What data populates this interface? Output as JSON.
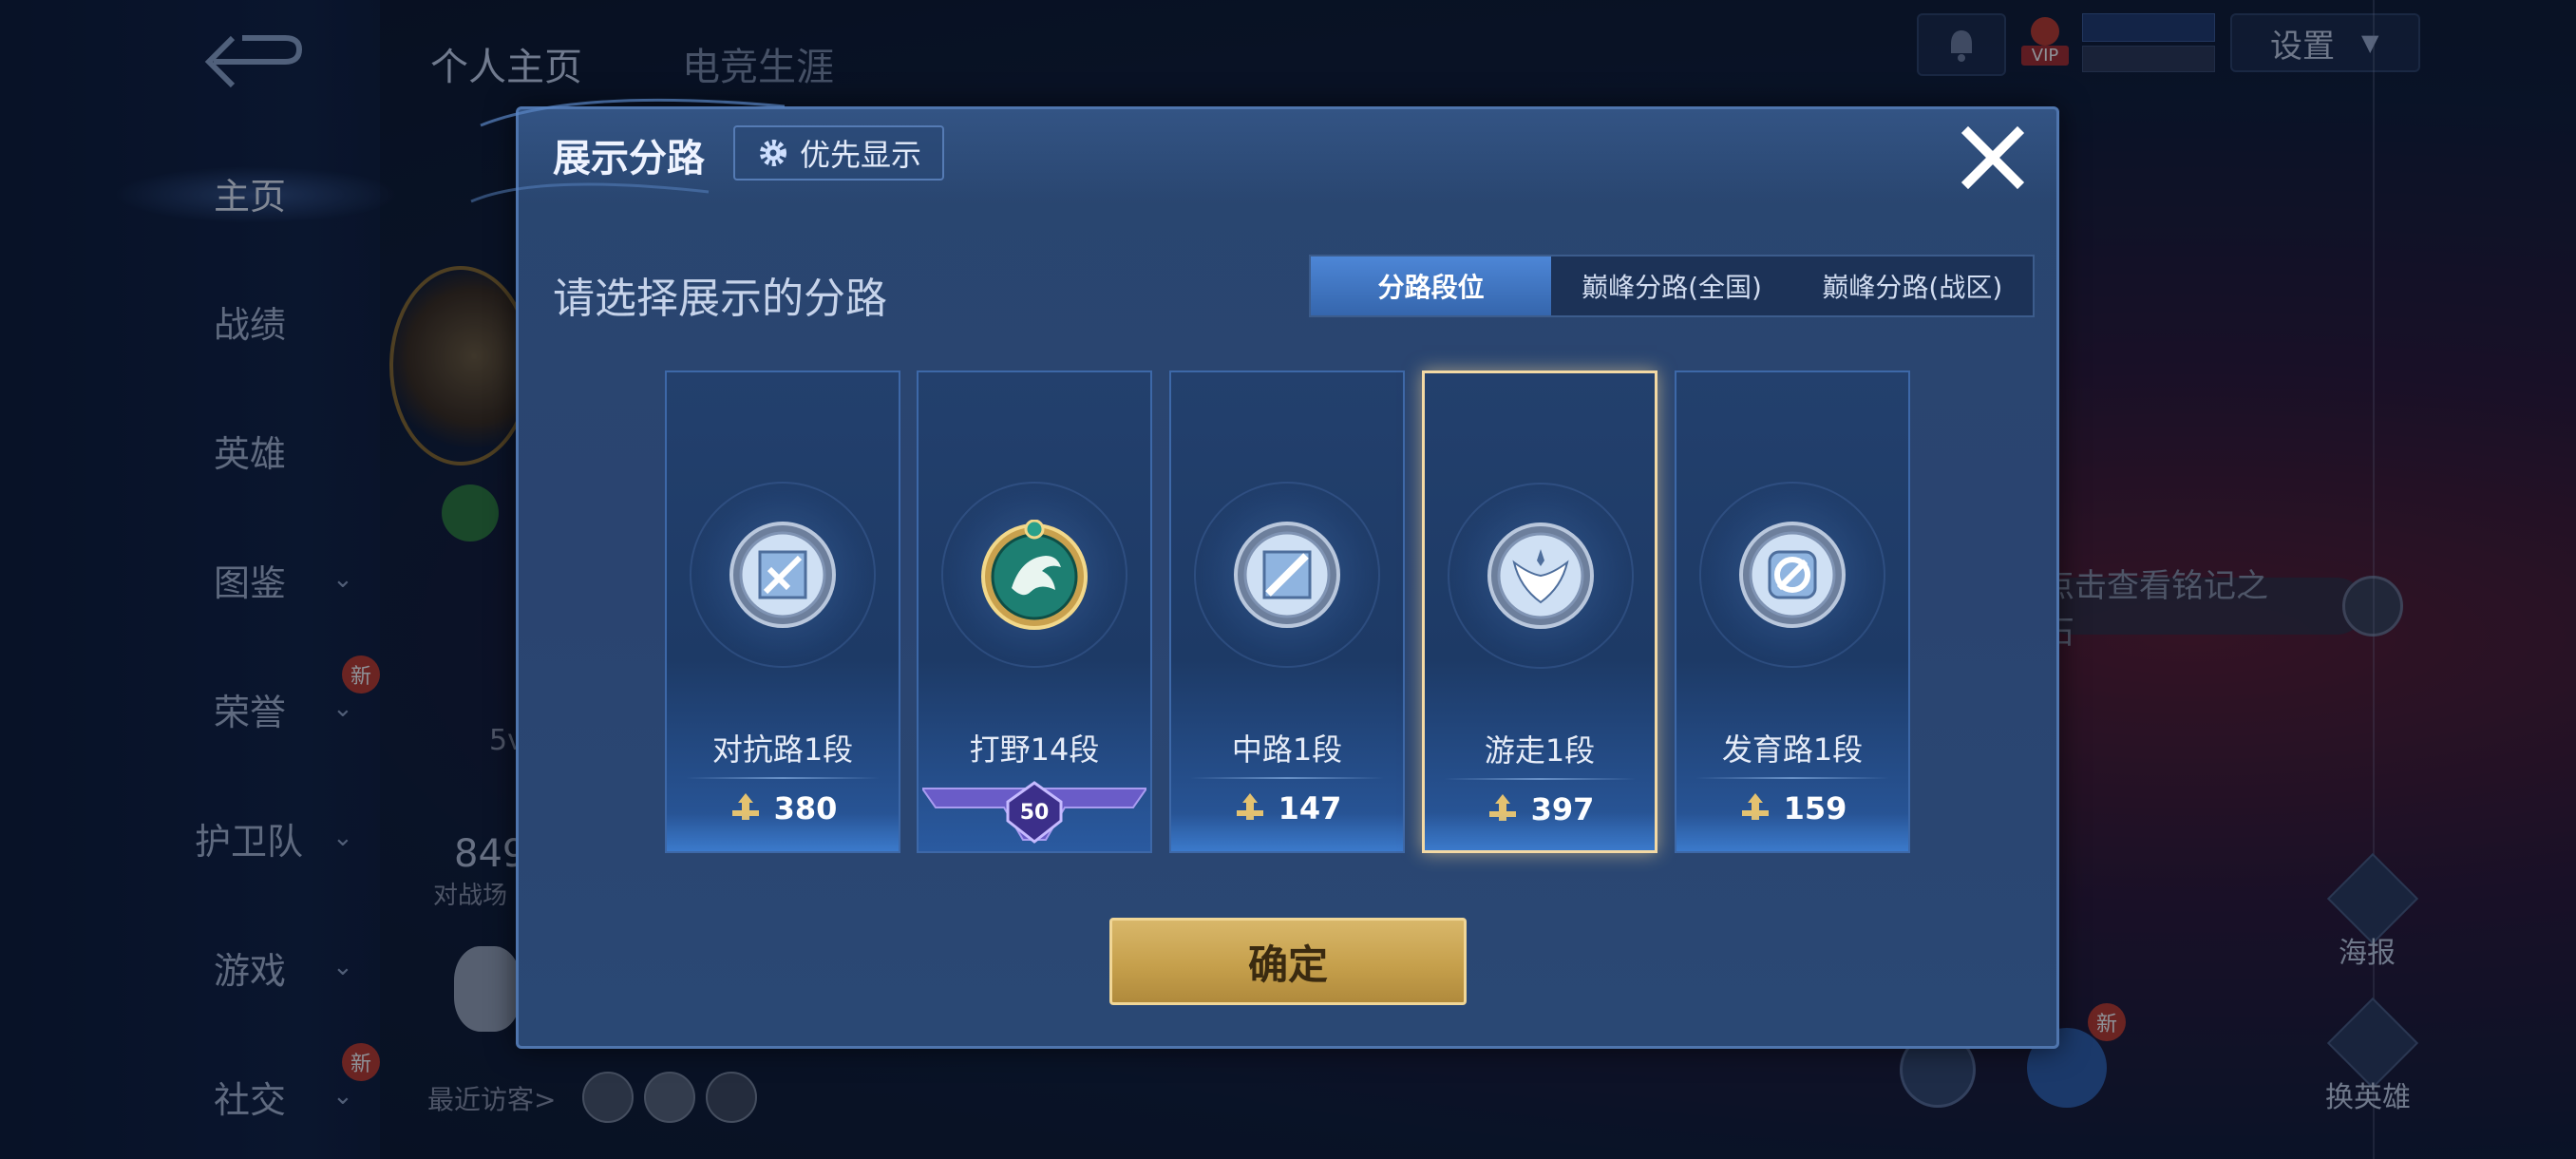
{
  "background": {
    "top_tabs": [
      "个人主页",
      "电竞生涯"
    ],
    "sidebar": [
      {
        "label": "主页",
        "active": true
      },
      {
        "label": "战绩"
      },
      {
        "label": "英雄"
      },
      {
        "label": "图鉴",
        "chevron": true
      },
      {
        "label": "荣誉",
        "chevron": true,
        "badge": "新"
      },
      {
        "label": "护卫队",
        "chevron": true
      },
      {
        "label": "游戏",
        "chevron": true
      },
      {
        "label": "社交",
        "chevron": true,
        "badge": "新"
      }
    ],
    "settings_label": "设置",
    "vip_label": "VIP",
    "mingwen_hint": "点击查看铭记之石",
    "poster_label": "海报",
    "change_hero_label": "换英雄",
    "recent_visitors_label": "最近访客>",
    "partial_count": "849",
    "partial_battle": "对战场",
    "partial_5v": "5v",
    "new_badge": "新"
  },
  "dialog": {
    "title": "展示分路",
    "priority_button": "优先显示",
    "subtitle": "请选择展示的分路",
    "tabs": [
      {
        "label": "分路段位",
        "active": true
      },
      {
        "label": "巅峰分路(全国)",
        "active": false
      },
      {
        "label": "巅峰分路(战区)",
        "active": false
      }
    ],
    "cards": [
      {
        "lane": "对抗路1段",
        "score": "380",
        "selected": false,
        "emblem": "clash-lane-emblem"
      },
      {
        "lane": "打野14段",
        "score": "",
        "rank_badge": "50",
        "selected": false,
        "emblem": "jungle-dragon-emblem"
      },
      {
        "lane": "中路1段",
        "score": "147",
        "selected": false,
        "emblem": "mid-lane-emblem"
      },
      {
        "lane": "游走1段",
        "score": "397",
        "selected": true,
        "emblem": "roam-wings-emblem"
      },
      {
        "lane": "发育路1段",
        "score": "159",
        "selected": false,
        "emblem": "farm-lane-emblem"
      }
    ],
    "confirm_button": "确定"
  }
}
